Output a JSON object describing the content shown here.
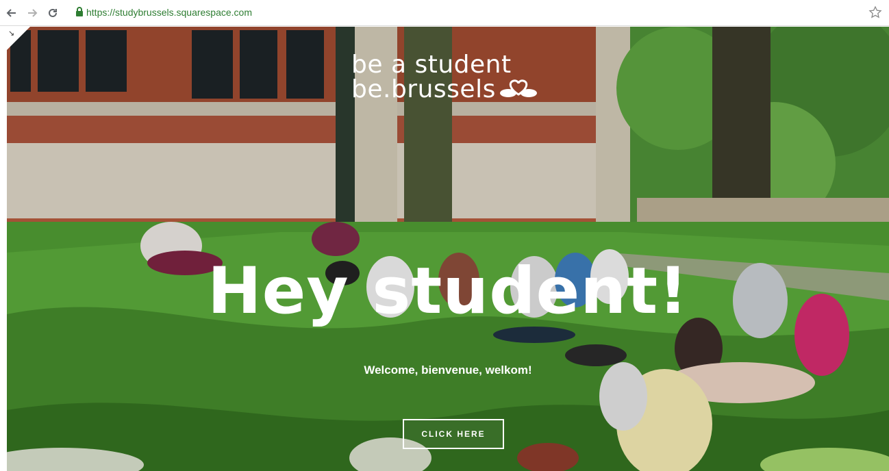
{
  "browser": {
    "url": "https://studybrussels.squarespace.com",
    "icons": [
      "back-arrow-icon",
      "forward-arrow-icon",
      "reload-icon",
      "lock-icon",
      "bookmark-star-icon"
    ],
    "secure_color": "#2e7d32"
  },
  "hero": {
    "logo_line1": "be a student",
    "logo_line2": "be.brussels",
    "headline": "Hey student!",
    "subheadline": "Welcome, bienvenue, welkom!",
    "cta_label": "CLICK HERE",
    "text_color": "#ffffff"
  }
}
